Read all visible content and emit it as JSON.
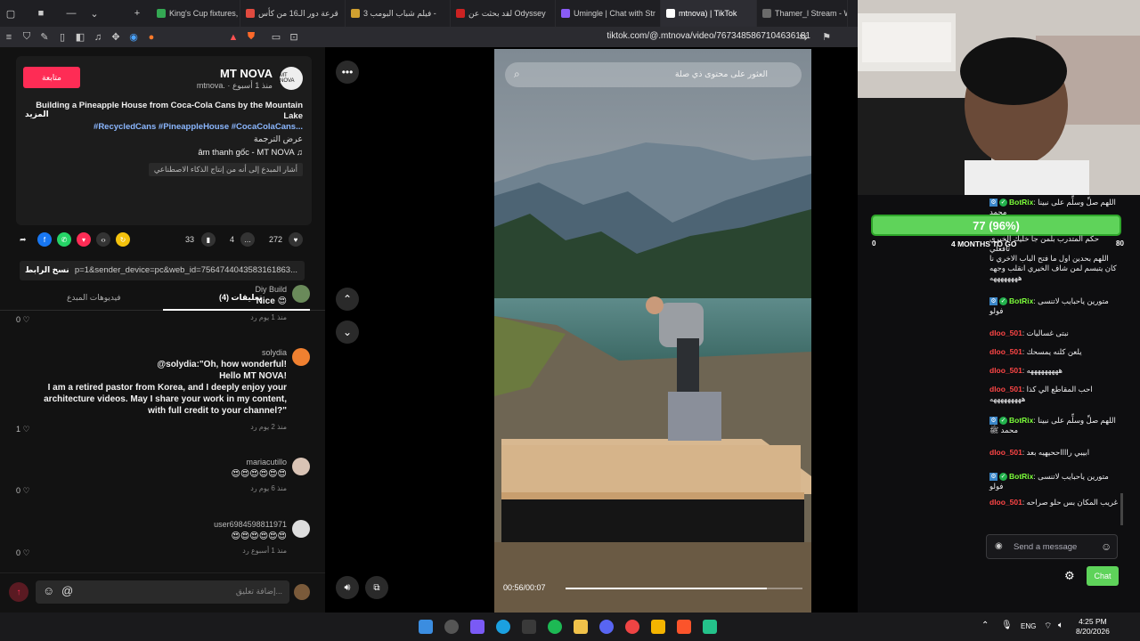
{
  "browser": {
    "tabs": [
      {
        "label": "King's Cup fixtures, res",
        "color": "#34a853"
      },
      {
        "label": "قرعة دور الـ16 من كأس",
        "color": "#e04a3f"
      },
      {
        "label": "فيلم شباب البومب 3 -",
        "color": "#d0a030"
      },
      {
        "label": "لقد بحثت عن Odyssey",
        "color": "#cc2222"
      },
      {
        "label": "Umingle | Chat with Str",
        "color": "#8a5cf6"
      },
      {
        "label": "mtnova) | TikTok",
        "color": "#ffffff",
        "active": true
      },
      {
        "label": "Thamer_l Stream - Wat",
        "color": "#6b6b6b"
      }
    ],
    "url": "tiktok.com/@.mtnova/video/7673485867104636181"
  },
  "post": {
    "follow_label": "متابعة",
    "author_name": "MT NOVA",
    "author_handle": "mtnova. · منذ 1 أسبوع",
    "avatar_text": "MT NOVA",
    "description": "Building a Pineapple House from Coca-Cola Cans by the Mountain Lake",
    "hashtags": "#RecycledCans #PineappleHouse #CocaColaCans...",
    "more_label": "المزيد",
    "translate_label": "عرض الترجمة",
    "sound": "âm thanh gốc - MT NOVA",
    "ai_note": "أشار المبدع إلى أنه من إنتاج الذكاء الاصطناعي",
    "likes": "272",
    "comments": "4",
    "saves": "33",
    "link": "p=1&sender_device=pc&web_id=7564744043583161863...",
    "copy_link_label": "نسخ الرابط",
    "tab_comments": "تعليقات (4)",
    "tab_creator": "فيديوهات المبدع"
  },
  "comments": [
    {
      "user": "Diy Build",
      "text": "Nice 😍",
      "meta": "منذ 1 يوم   رد",
      "likes": "0"
    },
    {
      "user": "solydia",
      "text": "@solydia:\"Oh, how wonderful!\nHello MT NOVA!\nI am a retired pastor from Korea, and I deeply enjoy your architecture videos. May I share your work in my content, with full credit to your channel?\"",
      "meta": "منذ 2 يوم   رد",
      "likes": "1"
    },
    {
      "user": "mariacutillo",
      "text": "😍😍😍😍😍😍",
      "meta": "منذ 6 يوم   رد",
      "likes": "0"
    },
    {
      "user": "user6984598811971",
      "text": "😍😍😍😍😍😍",
      "meta": "منذ 1 أسبوع   رد",
      "likes": "0"
    }
  ],
  "comment_placeholder": "إضافة تعليق...",
  "video": {
    "search_placeholder": "العثور على محتوى ذي صلة",
    "time": "00:56/00:07",
    "progress": 0.85
  },
  "stream": {
    "sub_goal": "77 (96%)",
    "sub_min": "0",
    "sub_max": "80",
    "sub_label": "4 MONTHS TO GO",
    "progress": 0.96,
    "messages": [
      {
        "user": "BotRix",
        "text": ": اللهم صلِّ وسلِّم على نبينا محمد",
        "color": "#7cff3a",
        "bot": true
      },
      {
        "user": "",
        "text": "حكم المتدرب بلمن جا خليك الخيري تافعلي \nاللهم بحدين اول ما فتح الباب الاخري نا كان يتبسم لمن شاف الخيري انقلب وجهه ههههههههه",
        "color": "#efeff1",
        "bot": false
      },
      {
        "user": "BotRix",
        "text": ": متورين ياحبايب لاتنسى فولو",
        "color": "#7cff3a",
        "bot": true
      },
      {
        "user": "dloo_501",
        "text": ": نبتى غساليات",
        "color": "#ff4646",
        "bot": false
      },
      {
        "user": "dloo_501",
        "text": ": يلعن كلنه يمسحك",
        "color": "#ff4646",
        "bot": false
      },
      {
        "user": "dloo_501",
        "text": ": هههههههههه",
        "color": "#ff4646",
        "bot": false
      },
      {
        "user": "dloo_501",
        "text": ": احب المقاطع الي كذا هههههههههه",
        "color": "#ff4646",
        "bot": false
      },
      {
        "user": "BotRix",
        "text": ": اللهم صلِّ وسلِّم على نبينا محمد ﷺ",
        "color": "#7cff3a",
        "bot": true
      },
      {
        "user": "dloo_501",
        "text": ": ابيبي رااااححيهيه بعد",
        "color": "#ff4646",
        "bot": false
      },
      {
        "user": "BotRix",
        "text": ": متورين ياحبايب لاتنسى فولو",
        "color": "#7cff3a",
        "bot": true
      },
      {
        "user": "dloo_501",
        "text": ": غريب المكان بس حلو صراحه",
        "color": "#ff4646",
        "bot": false
      }
    ],
    "chat_placeholder": "Send a message",
    "chat_button": "Chat"
  },
  "taskbar": {
    "lang": "ENG",
    "time": "4:25 PM",
    "date": "8/20/2026"
  }
}
